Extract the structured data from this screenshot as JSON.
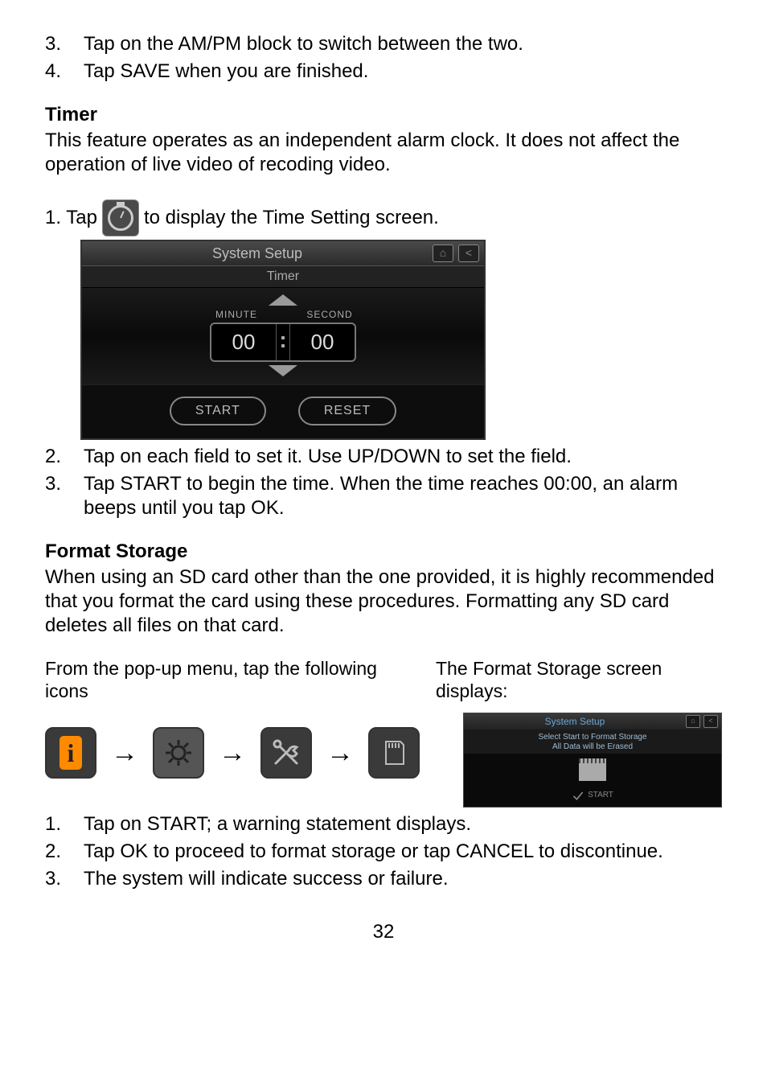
{
  "top_steps": [
    {
      "n": "3.",
      "t": "Tap on the AM/PM block to switch between the two."
    },
    {
      "n": "4.",
      "t": "Tap SAVE when you are finished."
    }
  ],
  "timer": {
    "heading": "Timer",
    "desc": "This feature operates as an independent alarm clock. It does not affect the operation of live video of recoding video.",
    "step1_prefix": "1. Tap",
    "step1_suffix": "to display the Time Setting screen.",
    "screenshot": {
      "header": "System Setup",
      "sub": "Timer",
      "minute_label": "MINUTE",
      "second_label": "SECOND",
      "minute_val": "00",
      "second_val": "00",
      "start": "START",
      "reset": "RESET"
    },
    "steps_after": [
      {
        "n": "2.",
        "t": "Tap on each field to set it. Use UP/DOWN to set the field."
      },
      {
        "n": "3.",
        "t": "Tap START to begin the time. When the time reaches 00:00, an alarm beeps until you tap OK."
      }
    ]
  },
  "format": {
    "heading": "Format Storage",
    "desc": "When using an SD card other than the one provided, it is highly recommended that you format the card using these procedures. Formatting any SD card deletes all files on that card.",
    "left_text": "From the pop-up menu, tap the following icons",
    "right_text": "The Format Storage screen displays:",
    "mini": {
      "header": "System Setup",
      "line1": "Select Start to Format Storage",
      "line2": "All Data will be Erased",
      "start": "START"
    },
    "steps": [
      {
        "n": "1.",
        "t": "Tap on START; a warning statement displays."
      },
      {
        "n": "2.",
        "t": "Tap OK to proceed to format storage or tap CANCEL to discontinue."
      },
      {
        "n": "3.",
        "t": "The system will indicate success or failure."
      }
    ]
  },
  "page_number": "32"
}
